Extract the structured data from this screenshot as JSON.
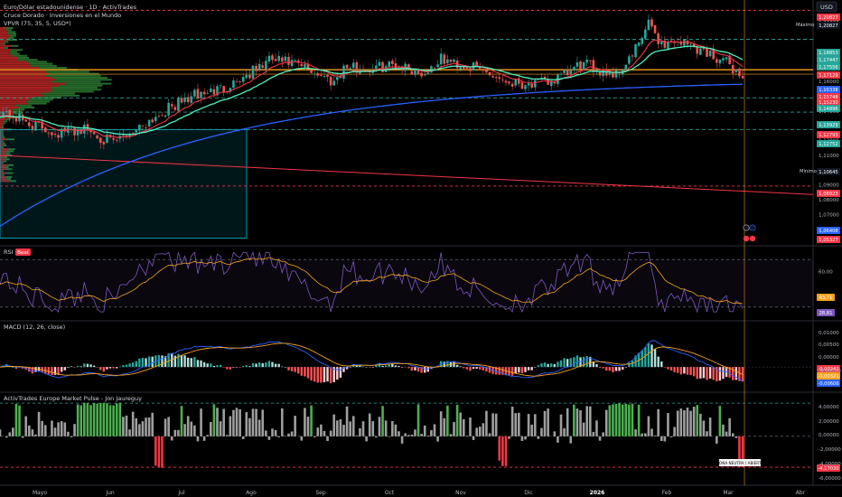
{
  "header": {
    "symbol_line": "Euro/Dólar estadounidense · 1D · ActivTrades",
    "strategy_line": "Cruce Dorado · Inversiones en el Mundo",
    "vpvr_line": "VPVR (75, 35, 5, USD*)",
    "currency_button": "USD"
  },
  "colors": {
    "background": "#000000",
    "up": "#26a69a",
    "down": "#ef5350",
    "ema_fast": "#f23645",
    "ema_mid": "#4ef0c0",
    "sma_slow": "#2962ff",
    "trendline": "#f23645",
    "box": "#00bcd4",
    "poc": "#f7a21b",
    "axis_text": "#b2b5be"
  },
  "price_pane": {
    "price_ticks": [
      "1,20000",
      "1,18000",
      "1,16000",
      "1,14000",
      "1,12000",
      "1,11000",
      "1,10000",
      "1,09000",
      "1,08000",
      "1,07000",
      "1,06000"
    ],
    "markers": {
      "maximo": {
        "label": "Máximo",
        "value": "1,20827"
      },
      "minimo": {
        "label": "Mínimo",
        "value": "1,10645"
      }
    },
    "price_tags": [
      {
        "text": "1,20827",
        "color": "#f23645"
      },
      {
        "text": "1,18853",
        "color": "#26a69a"
      },
      {
        "text": "1,17447",
        "color": "#26a69a"
      },
      {
        "text": "1,17556",
        "color": "#26a69a"
      },
      {
        "text": "1,17129",
        "color": "#f23645"
      },
      {
        "text": "1,16338",
        "color": "#2962ff"
      },
      {
        "text": "1,15748",
        "color": "#f23645"
      },
      {
        "text": "1,15230",
        "color": "#f23645"
      },
      {
        "text": "1,14896",
        "color": "#26a69a"
      },
      {
        "text": "1,13929",
        "color": "#26a69a"
      },
      {
        "text": "1,12793",
        "color": "#f23645"
      },
      {
        "text": "1,12752",
        "color": "#26a69a"
      },
      {
        "text": "1,08923",
        "color": "#f23645"
      },
      {
        "text": "1,06408",
        "color": "#2962ff"
      },
      {
        "text": "1,05327",
        "color": "#f23645"
      }
    ]
  },
  "rsi_pane": {
    "label": "RSI",
    "badge": "Beat",
    "ticks": [
      "60,00"
    ],
    "tags": [
      {
        "text": "43,71",
        "color": "#f7a21b"
      },
      {
        "text": "28,81",
        "color": "#7e57c2"
      }
    ]
  },
  "macd_pane": {
    "label": "MACD (12, 26, close)",
    "ticks": [
      "0,01000",
      "0,00500",
      "0,00000",
      "-0,00500"
    ],
    "tags": [
      {
        "text": "-0,00242",
        "color": "#f23645"
      },
      {
        "text": "-0,00321",
        "color": "#f7a21b"
      },
      {
        "text": "-0,00606",
        "color": "#2962ff"
      }
    ]
  },
  "pulse_pane": {
    "label": "ActivTrades Europe Market Pulse - Jon Jaureguy",
    "ticks": [
      "4,00000",
      "2,00000",
      "0,00000",
      "-2,00000",
      "-4,00000",
      "-6,00000"
    ],
    "tags": [
      {
        "text": "-4,17030",
        "color": "#f23645"
      }
    ],
    "annotation": "ZONA NEUTRA / ABIERTA"
  },
  "time_axis": {
    "months": [
      {
        "label": "Mayo",
        "bold": false
      },
      {
        "label": "Jun",
        "bold": false
      },
      {
        "label": "Jul",
        "bold": false
      },
      {
        "label": "Ago",
        "bold": false
      },
      {
        "label": "Sep",
        "bold": false
      },
      {
        "label": "Oct",
        "bold": false
      },
      {
        "label": "Nov",
        "bold": false
      },
      {
        "label": "Dic",
        "bold": false
      },
      {
        "label": "2026",
        "bold": true
      },
      {
        "label": "Feb",
        "bold": false
      },
      {
        "label": "Mar",
        "bold": false
      },
      {
        "label": "Abr",
        "bold": false
      }
    ]
  },
  "chart_data": {
    "type": "line",
    "y_scale": "price",
    "ylim": [
      1.05,
      1.214
    ],
    "x": [
      "Abr",
      "Mayo",
      "Jun",
      "Jul",
      "Ago",
      "Sep",
      "Oct",
      "Nov",
      "Dic",
      "2026",
      "Feb",
      "Mar"
    ],
    "series": [
      {
        "values": [
          1.135,
          1.12,
          1.135,
          1.168,
          1.17,
          1.17,
          1.165,
          1.157,
          1.162,
          1.172,
          1.185,
          1.16
        ]
      },
      {
        "values": [
          1.1,
          1.11,
          1.128,
          1.16,
          1.165,
          1.168,
          1.167,
          1.161,
          1.165,
          1.17,
          1.178,
          1.164
        ]
      },
      {
        "values": [
          1.065,
          1.085,
          1.103,
          1.12,
          1.14,
          1.15,
          1.155,
          1.158,
          1.161,
          1.163,
          1.165,
          1.163
        ]
      }
    ]
  }
}
